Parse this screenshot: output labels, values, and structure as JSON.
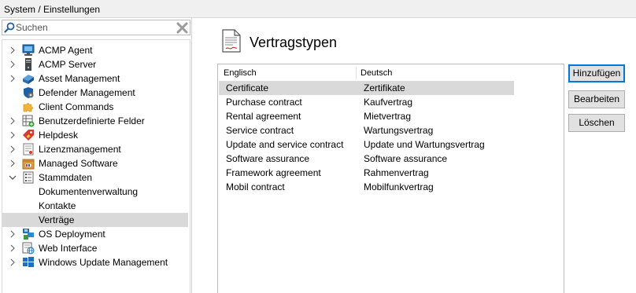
{
  "breadcrumb": {
    "text": "System / Einstellungen"
  },
  "search": {
    "placeholder": "Suchen",
    "value": ""
  },
  "tree": {
    "items": [
      {
        "label": "ACMP Agent",
        "icon": "monitor-icon",
        "expandable": true
      },
      {
        "label": "ACMP Server",
        "icon": "server-tower-icon",
        "expandable": true
      },
      {
        "label": "Asset Management",
        "icon": "asset-box-icon",
        "expandable": true
      },
      {
        "label": "Defender Management",
        "icon": "defender-shield-icon",
        "expandable": false
      },
      {
        "label": "Client Commands",
        "icon": "puzzle-icon",
        "expandable": false
      },
      {
        "label": "Benutzerdefinierte Felder",
        "icon": "custom-fields-grid-icon",
        "expandable": true
      },
      {
        "label": "Helpdesk",
        "icon": "tag-icon",
        "expandable": true
      },
      {
        "label": "Lizenzmanagement",
        "icon": "license-document-icon",
        "expandable": true
      },
      {
        "label": "Managed Software",
        "icon": "software-package-icon",
        "expandable": true
      },
      {
        "label": "Stammdaten",
        "icon": "master-data-list-icon",
        "expandable": true,
        "expanded": true
      },
      {
        "label": "Dokumentenverwaltung",
        "child": true
      },
      {
        "label": "Kontakte",
        "child": true
      },
      {
        "label": "Verträge",
        "child": true,
        "selected": true
      },
      {
        "label": "OS Deployment",
        "icon": "os-deployment-icon",
        "expandable": true
      },
      {
        "label": "Web Interface",
        "icon": "web-interface-icon",
        "expandable": true
      },
      {
        "label": "Windows Update Management",
        "icon": "windows-icon",
        "expandable": true
      }
    ]
  },
  "main": {
    "title": "Vertragstypen",
    "columns": {
      "english": "Englisch",
      "german": "Deutsch"
    },
    "rows": [
      {
        "en": "Certificate",
        "de": "Zertifikate",
        "selected": true
      },
      {
        "en": "Purchase contract",
        "de": "Kaufvertrag"
      },
      {
        "en": "Rental agreement",
        "de": "Mietvertrag"
      },
      {
        "en": "Service contract",
        "de": "Wartungsvertrag"
      },
      {
        "en": "Update and service contract",
        "de": "Update und Wartungsvertrag"
      },
      {
        "en": "Software assurance",
        "de": "Software assurance"
      },
      {
        "en": "Framework agreement",
        "de": "Rahmenvertrag"
      },
      {
        "en": "Mobil contract",
        "de": "Mobilfunkvertrag"
      }
    ]
  },
  "buttons": {
    "add": "Hinzufügen",
    "edit": "Bearbeiten",
    "delete": "Löschen"
  },
  "colors": {
    "selection": "#d9d9d9",
    "accent": "#0078d7",
    "button_face": "#e1e1e1",
    "toolbar_bg": "#f0f0f0"
  }
}
